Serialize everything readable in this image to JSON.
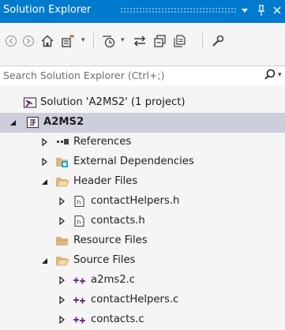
{
  "titlebar": {
    "title": "Solution Explorer",
    "pin_glyph": "▾",
    "pin2_glyph": "ᵖ",
    "close_glyph": "✕"
  },
  "toolbar": {
    "buttons": [
      "back-icon",
      "forward-icon",
      "home-icon",
      "switch-views-icon",
      "pending-changes-filter-icon",
      "sync-with-active-document-icon",
      "collapse-all-icon",
      "show-all-files-icon",
      "properties-icon"
    ]
  },
  "search": {
    "placeholder": "Search Solution Explorer (Ctrl+;)",
    "value": ""
  },
  "tree": {
    "solution": "Solution 'A2MS2' (1 project)",
    "project": "A2MS2",
    "references": "References",
    "external_dependencies": "External Dependencies",
    "header_files": "Header Files",
    "header_items": [
      "contactHelpers.h",
      "contacts.h"
    ],
    "resource_files": "Resource Files",
    "source_files": "Source Files",
    "source_items": [
      "a2ms2.c",
      "contactHelpers.c",
      "contacts.c"
    ]
  },
  "colors": {
    "accent": "#007acc",
    "selection": "#cccedb",
    "folder": "#dcb67a",
    "c_file": "#68217a"
  }
}
